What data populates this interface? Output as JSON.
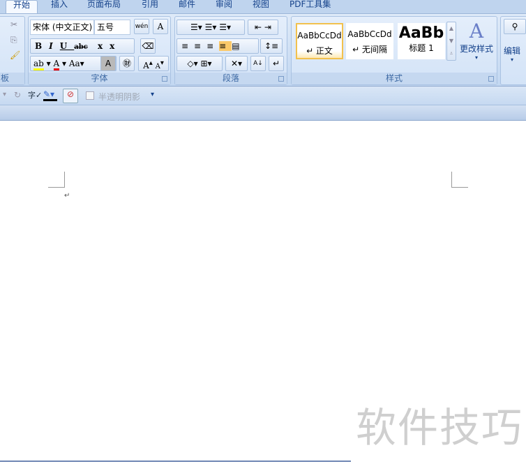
{
  "tabs": [
    "开始",
    "插入",
    "页面布局",
    "引用",
    "邮件",
    "审阅",
    "视图",
    "PDF工具集"
  ],
  "groups": {
    "clipboard": "板",
    "font": "字体",
    "paragraph": "段落",
    "styles": "样式",
    "edit": "编辑"
  },
  "font": {
    "name": "宋体 (中文正文)",
    "size": "五号"
  },
  "styles": [
    {
      "preview": "AaBbCcDd",
      "name": "↵ 正文"
    },
    {
      "preview": "AaBbCcDd",
      "name": "↵ 无间隔"
    },
    {
      "preview": "AaBb",
      "name": "标题 1"
    }
  ],
  "change_styles": "更改样式",
  "qat": {
    "shadow_label": "半透明阴影"
  },
  "doc": {
    "para_mark": "↵"
  },
  "watermark": "软件技巧"
}
